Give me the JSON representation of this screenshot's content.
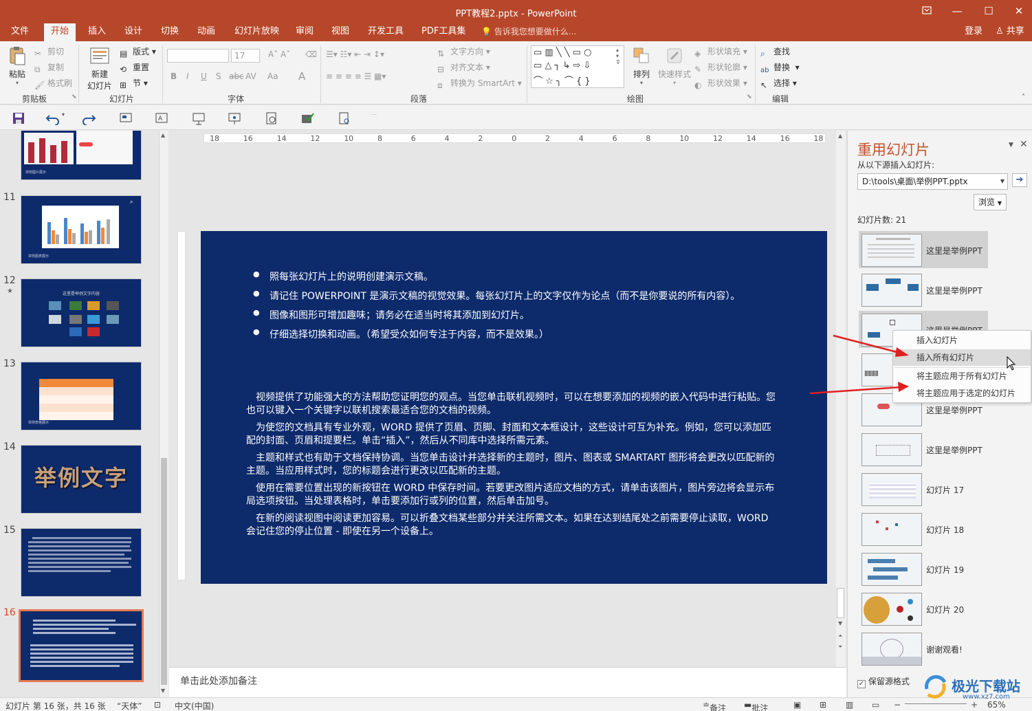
{
  "window": {
    "title": "PPT教程2.pptx - PowerPoint",
    "minimize": "—",
    "maximize": "☐",
    "close": "✕",
    "restore_icon": "ribbon-display-icon"
  },
  "tabs": [
    "文件",
    "开始",
    "插入",
    "设计",
    "切换",
    "动画",
    "幻灯片放映",
    "审阅",
    "视图",
    "开发工具",
    "PDF工具集"
  ],
  "active_tab": "开始",
  "tell_me": "告诉我您想要做什么...",
  "login": "登录",
  "share": "共享",
  "ribbon": {
    "clipboard": {
      "label": "剪贴板",
      "paste": "粘贴",
      "cut": "剪切",
      "copy": "复制",
      "format_painter": "格式刷"
    },
    "slides": {
      "label": "幻灯片",
      "new_slide": "新建\n幻灯片",
      "new_slide_line1": "新建",
      "new_slide_line2": "幻灯片",
      "layout": "版式",
      "reset": "重置",
      "section": "节"
    },
    "font": {
      "label": "字体",
      "font_name": "",
      "font_size": "17",
      "bold": "B",
      "italic": "I",
      "underline": "U",
      "shadow": "S",
      "strike": "abc",
      "spacing": "AV",
      "case": "Aa",
      "color": "A"
    },
    "paragraph": {
      "label": "段落",
      "text_direction": "文字方向",
      "align_text": "对齐文本",
      "convert_smartart": "转换为 SmartArt"
    },
    "drawing": {
      "label": "绘图",
      "arrange": "排列",
      "quick_styles": "快速样式",
      "shape_fill": "形状填充",
      "shape_outline": "形状轮廓",
      "shape_effects": "形状效果"
    },
    "editing": {
      "label": "编辑",
      "find": "查找",
      "replace": "替换",
      "select": "选择"
    }
  },
  "ruler": {
    "marks": [
      "18",
      "16",
      "14",
      "12",
      "10",
      "8",
      "6",
      "4",
      "2",
      "0",
      "2",
      "4",
      "6",
      "8",
      "10",
      "12",
      "14",
      "16",
      "18"
    ]
  },
  "thumbnails": [
    {
      "number": "",
      "caption": "举例图片展示"
    },
    {
      "number": "11",
      "caption": "举例图表展示"
    },
    {
      "number": "12",
      "star": "★",
      "title": "这里是举例文字内容"
    },
    {
      "number": "13",
      "caption": "举例表格展示"
    },
    {
      "number": "14",
      "art_text": "举例文字"
    },
    {
      "number": "15"
    },
    {
      "number": "16",
      "active": true
    }
  ],
  "slide": {
    "bullets": [
      "照每张幻灯片上的说明创建演示文稿。",
      "请记住 POWERPOINT 是演示文稿的视觉效果。每张幻灯片上的文字仅作为论点（而不是你要说的所有内容）。",
      "图像和图形可增加趣味；请务必在适当时将其添加到幻灯片。",
      "仔细选择切换和动画。（希望受众如何专注于内容，而不是效果。）"
    ],
    "paragraphs": [
      "视频提供了功能强大的方法帮助您证明您的观点。当您单击联机视频时，可以在想要添加的视频的嵌入代码中进行粘贴。您也可以键入一个关键字以联机搜索最适合您的文档的视频。",
      "为使您的文档具有专业外观，WORD 提供了页眉、页脚、封面和文本框设计，这些设计可互为补充。例如，您可以添加匹配的封面、页眉和提要栏。单击“插入”，然后从不同库中选择所需元素。",
      "主题和样式也有助于文档保持协调。当您单击设计并选择新的主题时，图片、图表或 SMARTART 图形将会更改以匹配新的主题。当应用样式时，您的标题会进行更改以匹配新的主题。",
      "使用在需要位置出现的新按钮在 WORD 中保存时间。若要更改图片适应文档的方式，请单击该图片，图片旁边将会显示布局选项按钮。当处理表格时，单击要添加行或列的位置，然后单击加号。",
      "在新的阅读视图中阅读更加容易。可以折叠文档某些部分并关注所需文本。如果在达到结尾处之前需要停止读取，WORD 会记住您的停止位置 - 即使在另一个设备上。"
    ]
  },
  "notes_placeholder": "单击此处添加备注",
  "reuse_pane": {
    "title": "重用幻灯片",
    "source_label": "从以下源插入幻灯片:",
    "source_path": "D:\\tools\\桌面\\举例PPT.pptx",
    "browse": "浏览",
    "slide_count": "幻灯片数: 21",
    "items": [
      {
        "label": "这里是举例PPT",
        "highlight": true
      },
      {
        "label": "这里是举例PPT"
      },
      {
        "label": "这里是举例PPT",
        "highlight": true
      },
      {
        "label": ""
      },
      {
        "label": "这里是举例PPT"
      },
      {
        "label": "这里是举例PPT"
      },
      {
        "label": "幻灯片 17"
      },
      {
        "label": "幻灯片 18"
      },
      {
        "label": "幻灯片 19"
      },
      {
        "label": "幻灯片 20"
      },
      {
        "label": "谢谢观看!"
      }
    ],
    "keep_format": "保留源格式"
  },
  "context_menu": {
    "items": [
      "插入幻灯片",
      "插入所有幻灯片",
      "将主题应用于所有幻灯片",
      "将主题应用于选定的幻灯片"
    ],
    "hover_index": 1
  },
  "status": {
    "slide_info": "幻灯片 第 16 张，共 16 张",
    "theme": "“天体”",
    "language": "中文(中国)",
    "notes": "备注",
    "comments": "批注",
    "zoom": "65%"
  },
  "watermark": {
    "name": "极光下载站",
    "url": "www.xz7.com"
  },
  "colors": {
    "accent": "#b7472a",
    "slide_bg": "#0d2a6b",
    "arrow": "#e02020"
  }
}
